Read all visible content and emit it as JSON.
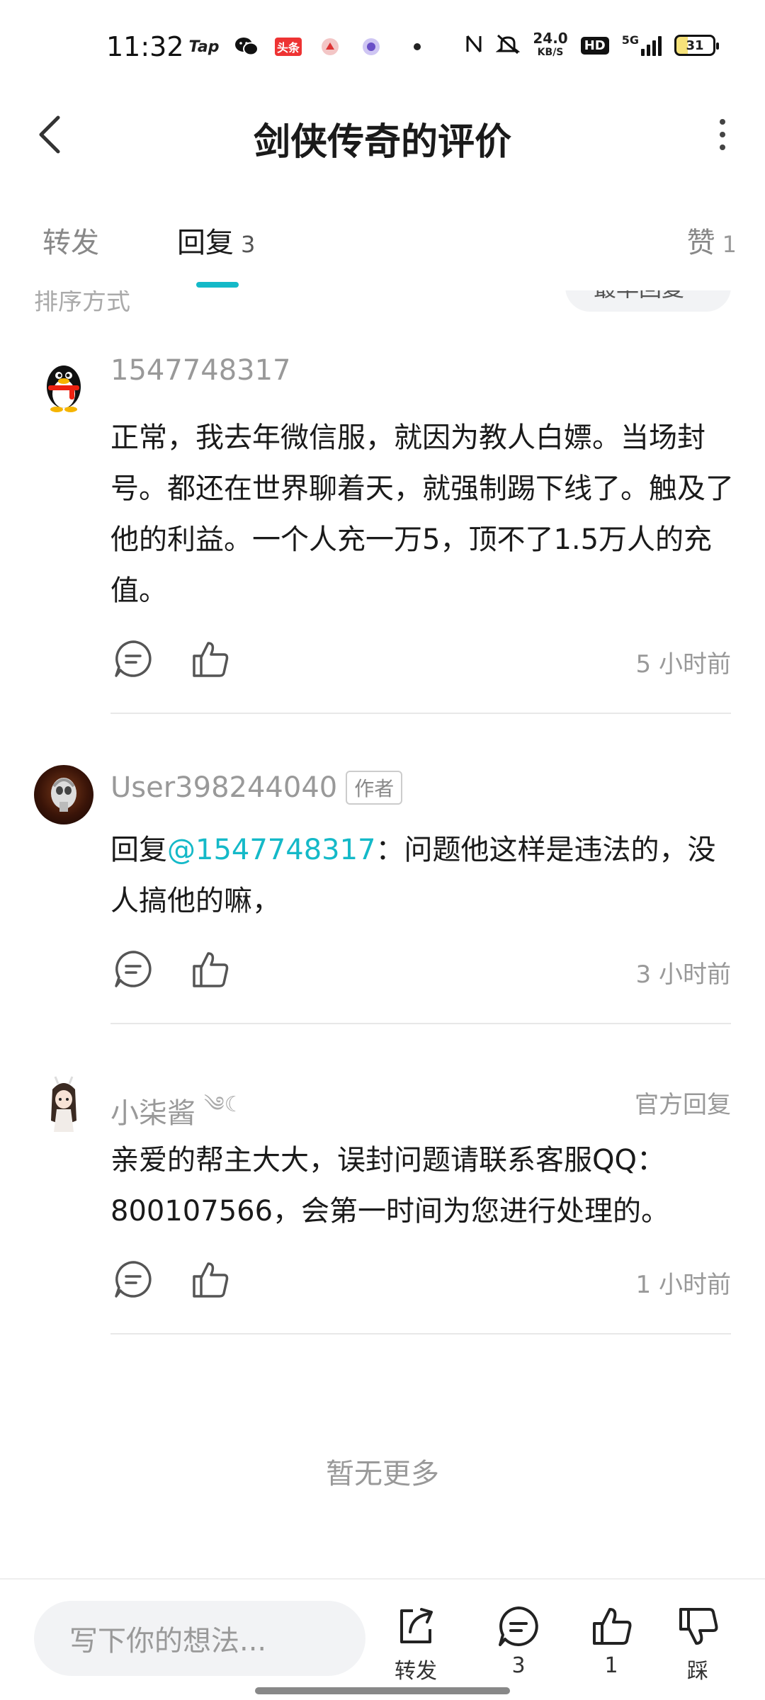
{
  "status_bar": {
    "time": "11:32",
    "left_icons": [
      "tap-app-icon",
      "wechat-icon",
      "toutiao-icon",
      "app-icon",
      "app-icon",
      "dot-icon"
    ],
    "tap_label": "Tap",
    "toutiao_label": "头条",
    "net_speed": "24.0",
    "net_speed_unit": "KB/S",
    "hd_label": "HD",
    "network": "5G",
    "battery": "31"
  },
  "header": {
    "title": "剑侠传奇的评价"
  },
  "tabs": {
    "forward": "转发",
    "reply": "回复",
    "reply_count": "3",
    "like": "赞",
    "like_count": "1"
  },
  "sort": {
    "label": "排序方式",
    "selected": "最早回复"
  },
  "comments": [
    {
      "username": "1547748317",
      "body": "正常，我去年微信服，就因为教人白嫖。当场封号。都还在世界聊着天，就强制踢下线了。触及了他的利益。一个人充一万5，顶不了1.5万人的充值。",
      "time": "5 小时前"
    },
    {
      "username": "User398244040",
      "tag": "作者",
      "reply_prefix": "回复",
      "mention": "@1547748317",
      "body": "：问题他这样是违法的，没人搞他的嘛，",
      "time": "3 小时前"
    },
    {
      "username": "小柒酱",
      "username_suffix": "༄☾",
      "official_tag": "官方回复",
      "body": "亲爱的帮主大大，误封问题请联系客服QQ：800107566，会第一时间为您进行处理的。",
      "time": "1 小时前"
    }
  ],
  "no_more": "暂无更多",
  "bottom_bar": {
    "placeholder": "写下你的想法...",
    "share_label": "转发",
    "comment_count": "3",
    "like_count": "1",
    "dislike_label": "踩"
  },
  "colors": {
    "accent": "#14b9c8",
    "text_primary": "#1a1a1a",
    "text_secondary": "#999999"
  }
}
